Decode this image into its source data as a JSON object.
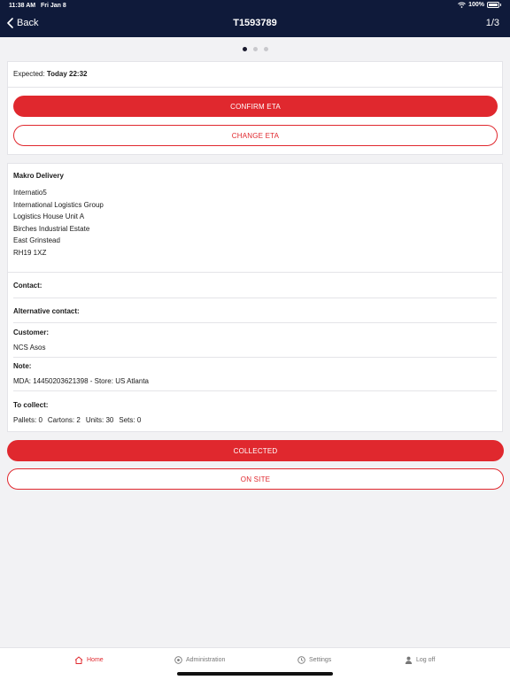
{
  "status": {
    "time": "11:38 AM",
    "date": "Fri Jan 8",
    "battery": "100%"
  },
  "nav": {
    "back_label": "Back",
    "title": "T1593789",
    "page_indicator": "1/3"
  },
  "pager": {
    "count": 3,
    "active": 0
  },
  "eta": {
    "expected_label": "Expected:",
    "expected_value": "Today 22:32",
    "confirm_label": "CONFIRM ETA",
    "change_label": "CHANGE ETA"
  },
  "delivery": {
    "name": "Makro Delivery",
    "address": [
      "Internatio5",
      "International Logistics Group",
      "Logistics House Unit A",
      "Birches Industrial Estate",
      "East Grinstead",
      "RH19 1XZ"
    ]
  },
  "fields": {
    "contact_label": "Contact:",
    "alt_contact_label": "Alternative contact:",
    "customer_label": "Customer:",
    "customer_value": "NCS Asos",
    "note_label": "Note:",
    "note_value": "MDA: 14450203621398 - Store: US Atlanta",
    "collect_label": "To collect:",
    "pallets": "Pallets: 0",
    "cartons": "Cartons: 2",
    "units": "Units: 30",
    "sets": "Sets: 0"
  },
  "actions": {
    "collected_label": "COLLECTED",
    "on_site_label": "ON SITE"
  },
  "tabs": [
    {
      "label": "Home",
      "icon": "home-icon",
      "active": true
    },
    {
      "label": "Administration",
      "icon": "administration-icon",
      "active": false
    },
    {
      "label": "Settings",
      "icon": "settings-icon",
      "active": false
    },
    {
      "label": "Log off",
      "icon": "user-icon",
      "active": false
    }
  ],
  "colors": {
    "header_bg": "#0f1a3a",
    "accent": "#e0282e",
    "background": "#f2f2f4"
  }
}
